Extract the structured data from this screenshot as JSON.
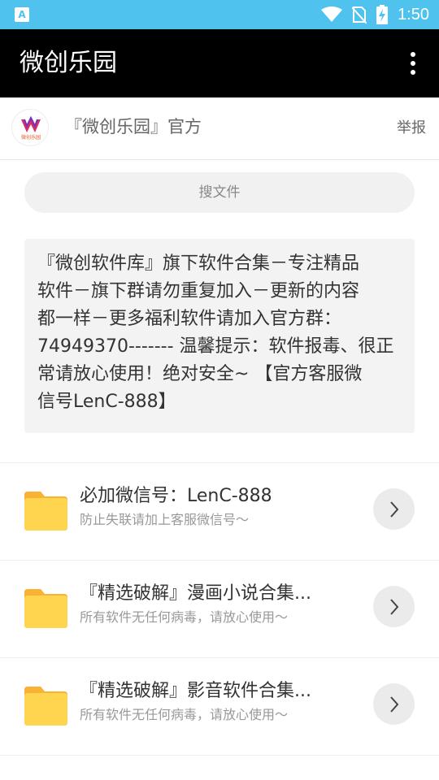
{
  "status_bar": {
    "time": "1:50",
    "icons": [
      "app-notification-icon",
      "wifi-icon",
      "no-sim-icon",
      "battery-charging-icon"
    ]
  },
  "toolbar": {
    "title": "微创乐园",
    "menu_icon": "more-vert-icon"
  },
  "header": {
    "name": "『微创乐园』官方",
    "report_label": "举报",
    "logo_text": "微创乐园"
  },
  "search": {
    "placeholder": "搜文件"
  },
  "notice": {
    "lines": [
      "『微创软件库』旗下软件合集－专注精品",
      "软件－旗下群请勿重复加入－更新的内容",
      "都一样－更多福利软件请加入官方群：",
      "74949370------- 温馨提示：软件报毒、很正",
      "常请放心使用！绝对安全~ 【官方客服微",
      "信号LenC-888】"
    ]
  },
  "items": [
    {
      "title": "必加微信号：LenC-888",
      "subtitle": "防止失联请加上客服微信号～"
    },
    {
      "title": "『精选破解』漫画小说合集...",
      "subtitle": "所有软件无任何病毒，请放心使用～"
    },
    {
      "title": "『精选破解』影音软件合集...",
      "subtitle": "所有软件无任何病毒，请放心使用～"
    }
  ],
  "colors": {
    "status_bar": "#4fc3ee",
    "toolbar": "#000000",
    "folder": "#ffd54f",
    "folder_tab": "#f9b233"
  }
}
